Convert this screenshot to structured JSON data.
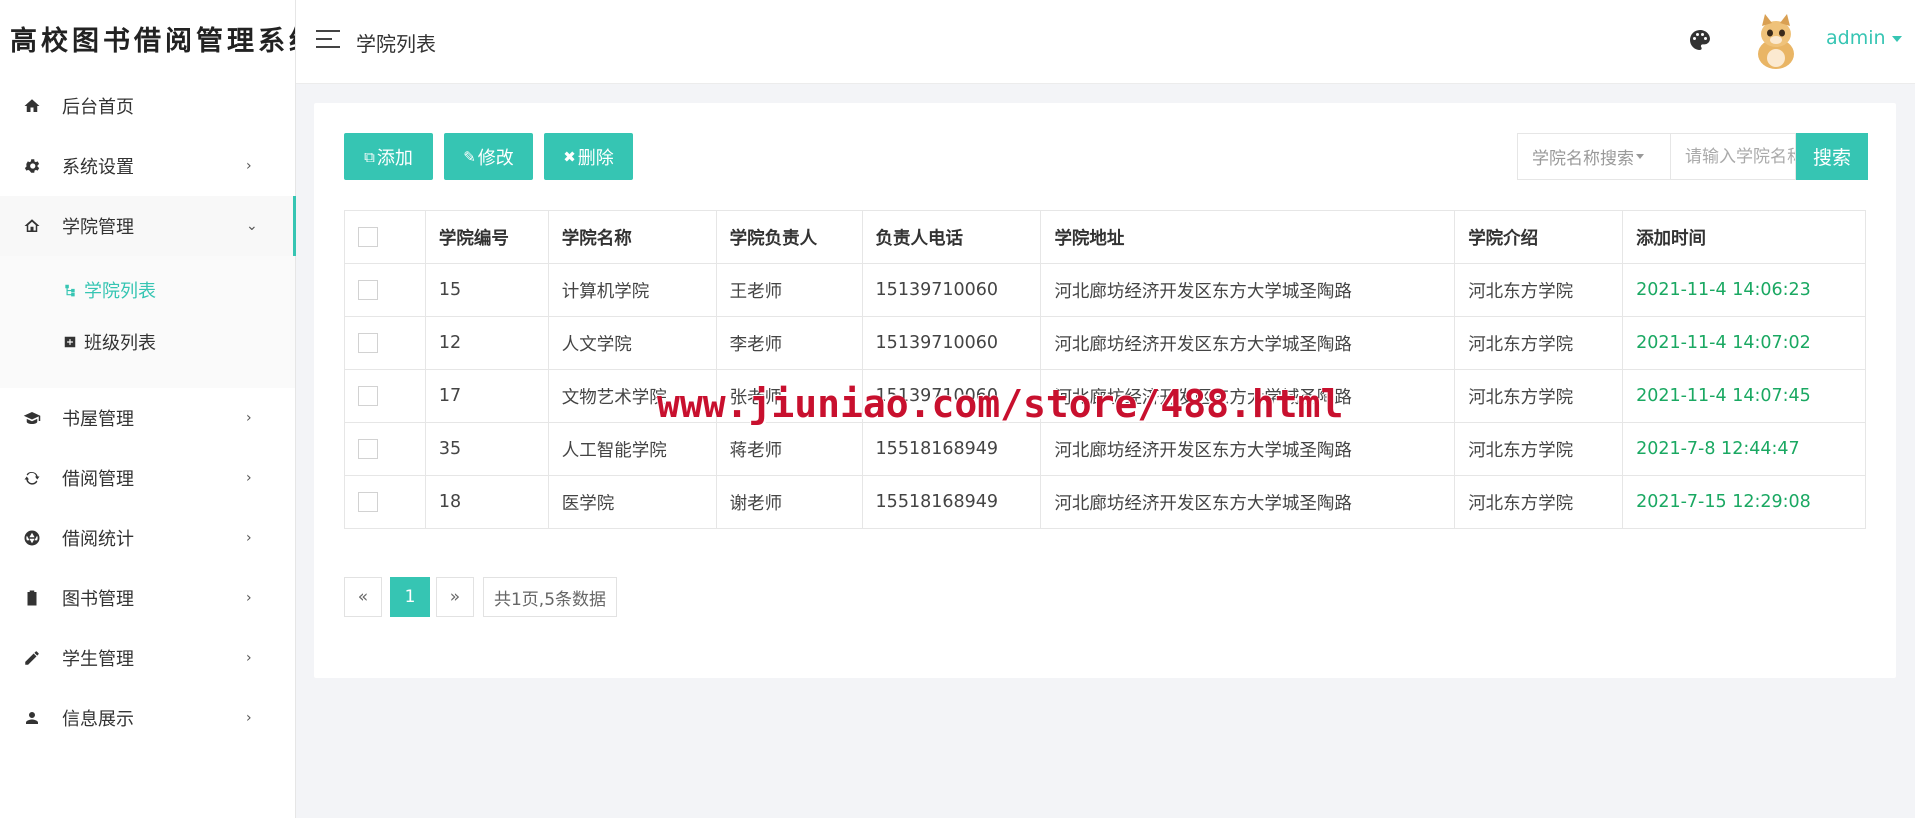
{
  "brand": {
    "title": "高校图书借阅管理系统"
  },
  "sidebar": {
    "items": [
      {
        "label": "后台首页",
        "icon": "home-icon"
      },
      {
        "label": "系统设置",
        "icon": "gear-icon"
      },
      {
        "label": "学院管理",
        "icon": "house-outline-icon",
        "open": true,
        "children": [
          {
            "label": "学院列表",
            "icon": "tree-icon",
            "active": true
          },
          {
            "label": "班级列表",
            "icon": "plus-box-icon"
          }
        ]
      },
      {
        "label": "书屋管理",
        "icon": "graduation-cap-icon"
      },
      {
        "label": "借阅管理",
        "icon": "exchange-icon"
      },
      {
        "label": "借阅统计",
        "icon": "aperture-icon"
      },
      {
        "label": "图书管理",
        "icon": "clipboard-icon"
      },
      {
        "label": "学生管理",
        "icon": "pencil-icon"
      },
      {
        "label": "信息展示",
        "icon": "user-icon"
      }
    ],
    "chevron_right": "›",
    "chevron_down": "⌄"
  },
  "header": {
    "page_title": "学院列表",
    "user": "admin"
  },
  "toolbar": {
    "add": "添加",
    "edit": "修改",
    "delete": "删除",
    "search_field": "学院名称搜索",
    "search_placeholder": "请输入学院名称",
    "search_button": "搜索"
  },
  "table": {
    "columns": [
      "学院编号",
      "学院名称",
      "学院负责人",
      "负责人电话",
      "学院地址",
      "学院介绍",
      "添加时间"
    ],
    "rows": [
      [
        "15",
        "计算机学院",
        "王老师",
        "15139710060",
        "河北廊坊经济开发区东方大学城圣陶路",
        "河北东方学院",
        "2021-11-4 14:06:23"
      ],
      [
        "12",
        "人文学院",
        "李老师",
        "15139710060",
        "河北廊坊经济开发区东方大学城圣陶路",
        "河北东方学院",
        "2021-11-4 14:07:02"
      ],
      [
        "17",
        "文物艺术学院",
        "张老师",
        "15139710060",
        "河北廊坊经济开发区东方大学城圣陶路",
        "河北东方学院",
        "2021-11-4 14:07:45"
      ],
      [
        "35",
        "人工智能学院",
        "蒋老师",
        "15518168949",
        "河北廊坊经济开发区东方大学城圣陶路",
        "河北东方学院",
        "2021-7-8 12:44:47"
      ],
      [
        "18",
        "医学院",
        "谢老师",
        "15518168949",
        "河北廊坊经济开发区东方大学城圣陶路",
        "河北东方学院",
        "2021-7-15 12:29:08"
      ]
    ]
  },
  "pagination": {
    "prev": "«",
    "current": "1",
    "next": "»",
    "summary": "共1页,5条数据"
  },
  "watermark": "www.jiuniao.com/store/488.html",
  "colors": {
    "accent": "#36c5b3",
    "time_green": "#1aa862",
    "watermark": "#c8102e"
  }
}
